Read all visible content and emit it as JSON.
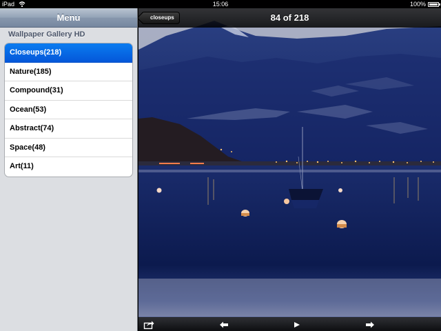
{
  "status_bar": {
    "carrier": "iPad",
    "time": "15:06",
    "battery": "100%"
  },
  "menu": {
    "title": "Menu",
    "section_header": "Wallpaper Gallery HD",
    "items": [
      {
        "label": "Closeups(218)",
        "selected": true
      },
      {
        "label": "Nature(185)",
        "selected": false
      },
      {
        "label": "Compound(31)",
        "selected": false
      },
      {
        "label": "Ocean(53)",
        "selected": false
      },
      {
        "label": "Abstract(74)",
        "selected": false
      },
      {
        "label": "Space(48)",
        "selected": false
      },
      {
        "label": "Art(11)",
        "selected": false
      }
    ]
  },
  "viewer": {
    "back_label": "closeups",
    "counter": "84 of 218",
    "toolbar_icons": [
      "share-icon",
      "previous-arrow-icon",
      "play-icon",
      "next-arrow-icon"
    ]
  },
  "colors": {
    "selection": "#0a6ee6",
    "sky": "#a1a7bd",
    "water": "#0c1a50"
  }
}
